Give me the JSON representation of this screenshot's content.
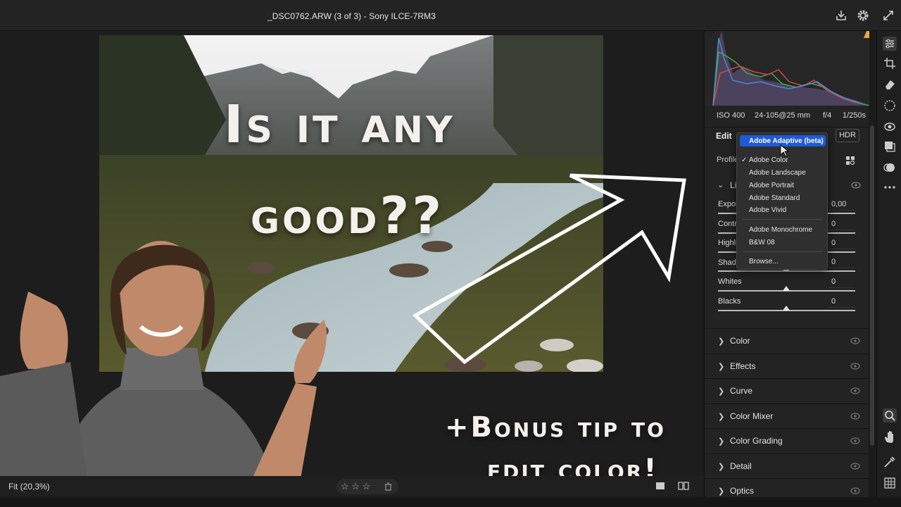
{
  "window": {
    "title": "_DSC0762.ARW (3 of 3)  -  Sony ILCE-7RM3"
  },
  "overlay": {
    "headline_line1": "Is it any",
    "headline_line2": "good??",
    "bonus_line1": "+Bonus tip to",
    "bonus_line2": "edit color!"
  },
  "exif": {
    "iso": "ISO 400",
    "lens": "24-105@25 mm",
    "aperture": "f/4",
    "shutter": "1/250s"
  },
  "edit_panel": {
    "title": "Edit",
    "hdr_button": "HDR",
    "profile_label": "Profile",
    "light_section": "Li",
    "sliders": [
      {
        "label": "Expos",
        "value": "0,00"
      },
      {
        "label": "Contr",
        "value": "0"
      },
      {
        "label": "Highli",
        "value": "0"
      },
      {
        "label": "Shado",
        "value": "0"
      },
      {
        "label": "Whites",
        "value": "0"
      },
      {
        "label": "Blacks",
        "value": "0"
      }
    ],
    "sections": [
      "Color",
      "Effects",
      "Curve",
      "Color Mixer",
      "Color Grading",
      "Detail",
      "Optics"
    ]
  },
  "profile_menu": {
    "selected": "Adobe Adaptive (beta)",
    "checked": "Adobe Color",
    "items": [
      "Adobe Landscape",
      "Adobe Portrait",
      "Adobe Standard",
      "Adobe Vivid"
    ],
    "group2": [
      "Adobe Monochrome",
      "B&W 08"
    ],
    "browse": "Browse..."
  },
  "bottom": {
    "zoom": "Fit (20,3%)",
    "rating_stars": "☆ ☆ ☆"
  },
  "colors": {
    "accent": "#1f5bd1",
    "panel": "#232323",
    "bg": "#1b1b1b"
  },
  "icons": [
    "save-icon",
    "gear-icon",
    "fullscreen-icon",
    "sliders-icon",
    "crop-icon",
    "eraser-icon",
    "mask-icon",
    "redeye-icon",
    "presets-icon",
    "snapshot-icon",
    "more-icon",
    "zoom-icon",
    "hand-icon",
    "eyedropper-icon",
    "grid-icon",
    "eye-icon",
    "trash-icon",
    "grid-view-icon"
  ]
}
